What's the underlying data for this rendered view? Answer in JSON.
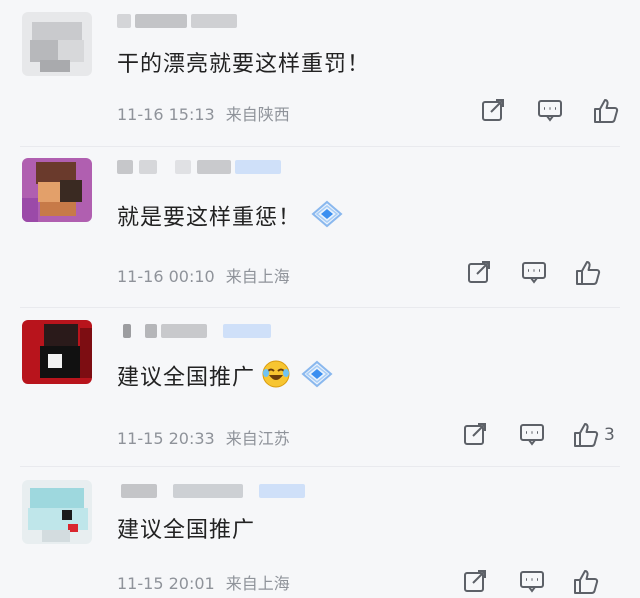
{
  "comments": [
    {
      "text": "干的漂亮就要这样重罚！",
      "time": "11-16 15:13",
      "location": "来自陕西",
      "like_count": ""
    },
    {
      "text": "就是要这样重惩！",
      "time": "11-16 00:10",
      "location": "来自上海",
      "like_count": ""
    },
    {
      "text": "建议全国推广",
      "time": "11-15 20:33",
      "location": "来自江苏",
      "like_count": "3"
    },
    {
      "text": "建议全国推广",
      "time": "11-15 20:01",
      "location": "来自上海",
      "like_count": ""
    }
  ],
  "icons": {
    "share": "share-icon",
    "comment": "comment-icon",
    "like": "like-icon",
    "emoji_laugh": "laugh-emoji-icon",
    "emoji_diamond": "diamond-sticker-icon"
  },
  "colors": {
    "text_primary": "#222222",
    "text_meta": "#8f939a",
    "icon": "#5d6168",
    "badge": "#cfe0f9"
  }
}
